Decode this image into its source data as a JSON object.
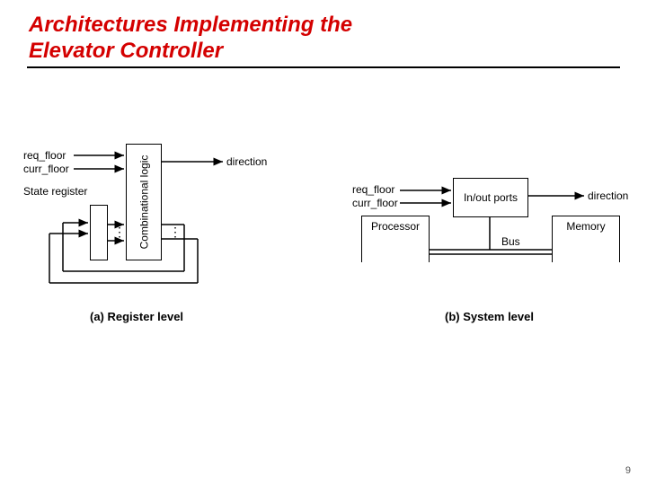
{
  "title_line1": "Architectures Implementing the",
  "title_line2": "Elevator Controller",
  "page_number": "9",
  "diagram_a": {
    "caption": "(a) Register level",
    "inputs": {
      "req": "req_floor",
      "curr": "curr_floor"
    },
    "output": "direction",
    "state_reg": "State register",
    "comb": "Combinational logic"
  },
  "diagram_b": {
    "caption": "(b) System level",
    "inputs": {
      "req": "req_floor",
      "curr": "curr_floor"
    },
    "output": "direction",
    "ioports": "In/out ports",
    "processor": "Processor",
    "memory": "Memory",
    "bus": "Bus"
  }
}
